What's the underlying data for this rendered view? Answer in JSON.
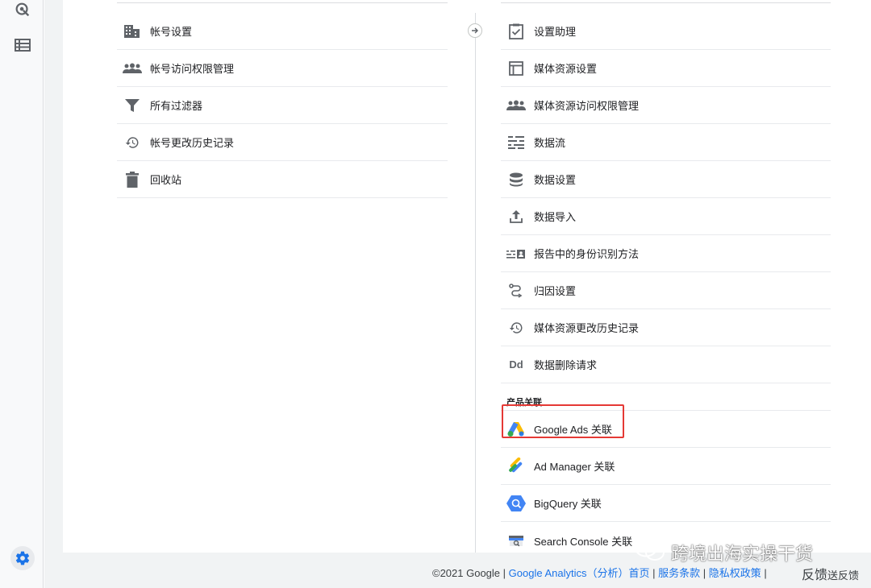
{
  "left_menu": [
    {
      "label": "帐号设置",
      "icon": "building-icon"
    },
    {
      "label": "帐号访问权限管理",
      "icon": "people-icon"
    },
    {
      "label": "所有过滤器",
      "icon": "filter-icon"
    },
    {
      "label": "帐号更改历史记录",
      "icon": "history-icon"
    },
    {
      "label": "回收站",
      "icon": "trash-icon"
    }
  ],
  "right_menu": [
    {
      "label": "设置助理",
      "icon": "checklist-icon"
    },
    {
      "label": "媒体资源设置",
      "icon": "window-icon"
    },
    {
      "label": "媒体资源访问权限管理",
      "icon": "people-icon"
    },
    {
      "label": "数据流",
      "icon": "stream-icon"
    },
    {
      "label": "数据设置",
      "icon": "database-icon"
    },
    {
      "label": "数据导入",
      "icon": "upload-icon"
    },
    {
      "label": "报告中的身份识别方法",
      "icon": "identity-icon"
    },
    {
      "label": "归因设置",
      "icon": "attribution-icon"
    },
    {
      "label": "媒体资源更改历史记录",
      "icon": "history-icon"
    },
    {
      "label": "数据删除请求",
      "icon": "dd-icon"
    }
  ],
  "product_links": {
    "heading": "产品关联",
    "items": [
      {
        "label": "Google Ads 关联",
        "icon": "google-ads-icon"
      },
      {
        "label": "Ad Manager 关联",
        "icon": "ad-manager-icon"
      },
      {
        "label": "BigQuery 关联",
        "icon": "bigquery-icon"
      },
      {
        "label": "Search Console 关联",
        "icon": "search-console-icon"
      }
    ]
  },
  "dd_text": "Dd",
  "footer": {
    "copyright": "©2021 Google",
    "sep": " | ",
    "analytics": "Google Analytics（分析）首页",
    "terms": "服务条款",
    "privacy": "隐私权政策"
  },
  "watermark": "跨境出海实操干货",
  "feedback": {
    "big": "反馈",
    "small": "送反馈"
  },
  "colors": {
    "highlight": "#e53935",
    "link": "#1a73e8",
    "settings": "#1a73e8"
  }
}
